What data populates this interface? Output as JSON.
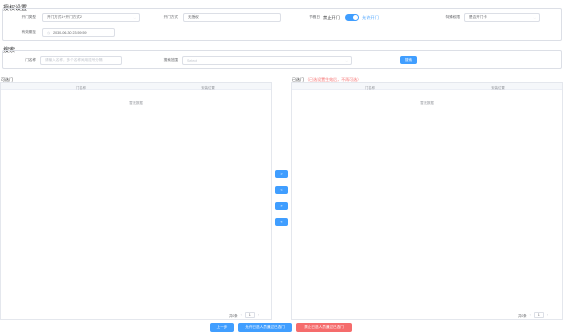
{
  "auth_settings": {
    "title": "授权设置",
    "door_type_label": "开门类型",
    "door_type_value": "开门方式1+开门方式2",
    "door_method_label": "开门方式",
    "door_method_value": "无授权",
    "holiday_label": "节假日",
    "holiday_off": "禁止开门",
    "holiday_on": "允许开门",
    "time_label": "特殊权限",
    "time_value": "是否开门卡",
    "expire_label": "有效期至",
    "expire_value": "2030-06-30 23:59:59"
  },
  "search": {
    "title": "搜索",
    "door_name_label": "门名称",
    "door_name_placeholder": "请输入名称，多个名称间用逗号分隔",
    "range_label": "搜索范围",
    "range_placeholder": "Select",
    "search_button": "搜索"
  },
  "left_panel": {
    "title": "可选门",
    "col_name": "门名称",
    "col_location": "安装位置",
    "empty_text": "暂无数据",
    "total_label": "共0条",
    "page": "1"
  },
  "right_panel": {
    "title": "已选门",
    "hint": "（已选设置生效后，不再可选）",
    "col_name": "门名称",
    "col_location": "安装位置",
    "empty_text": "暂无数据",
    "total_label": "共0条",
    "page": "1"
  },
  "transfer": {
    "add": ">",
    "remove": "<",
    "add_all": "»",
    "remove_all": "«"
  },
  "footer": {
    "prev_button": "上一步",
    "grant_button": "允许已选人员通过已选门",
    "deny_button": "禁止已选人员通过已选门"
  },
  "colors": {
    "accent": "#409eff",
    "danger": "#f56c6c",
    "hint_red": "#f56c6c"
  }
}
